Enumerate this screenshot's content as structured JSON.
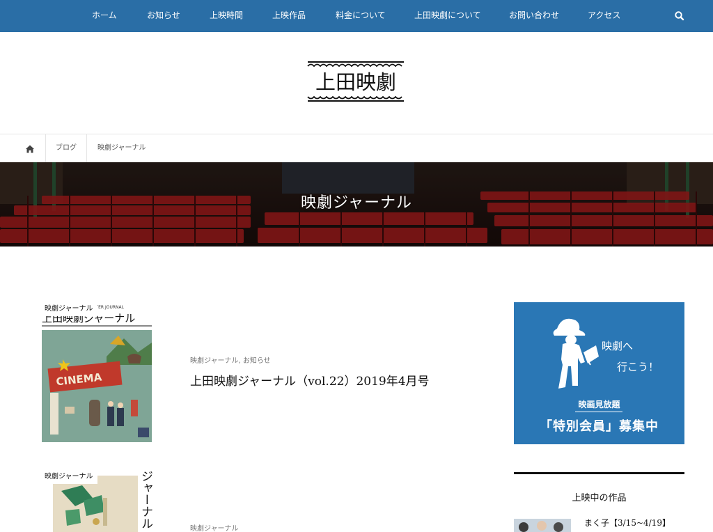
{
  "nav": {
    "items": [
      "ホーム",
      "お知らせ",
      "上映時間",
      "上映作品",
      "料金について",
      "上田映劇について",
      "お問い合わせ",
      "アクセス"
    ],
    "search_icon": "search-icon",
    "bg_color": "#2a6ea6"
  },
  "logo": {
    "text": "上田映劇"
  },
  "breadcrumb": {
    "home_icon": "home-icon",
    "items": [
      "ブログ",
      "映劇ジャーナル"
    ]
  },
  "hero": {
    "title": "映劇ジャーナル"
  },
  "posts": [
    {
      "badge": "映劇ジャーナル",
      "category": "映劇ジャーナル, お知らせ",
      "title": "上田映劇ジャーナル（vol.22）2019年4月号",
      "thumb": {
        "header_small": "EATER JOURNAL",
        "header": "上田映劇ジャーナル",
        "sign": "CINEMA"
      }
    },
    {
      "badge": "映劇ジャーナル",
      "category": "映劇ジャーナル",
      "title": "",
      "thumb": {
        "vertical": "ジャーナル"
      }
    }
  ],
  "sidebar": {
    "banner": {
      "handwriting_1": "映劇へ",
      "handwriting_2": "行こう！",
      "label_small": "映画見放題",
      "label_big": "「特別会員」募集中",
      "bg_color": "#2a77b5"
    },
    "widget": {
      "title": "上映中の作品",
      "items": [
        "まく子【3/15~4/19】"
      ]
    }
  }
}
